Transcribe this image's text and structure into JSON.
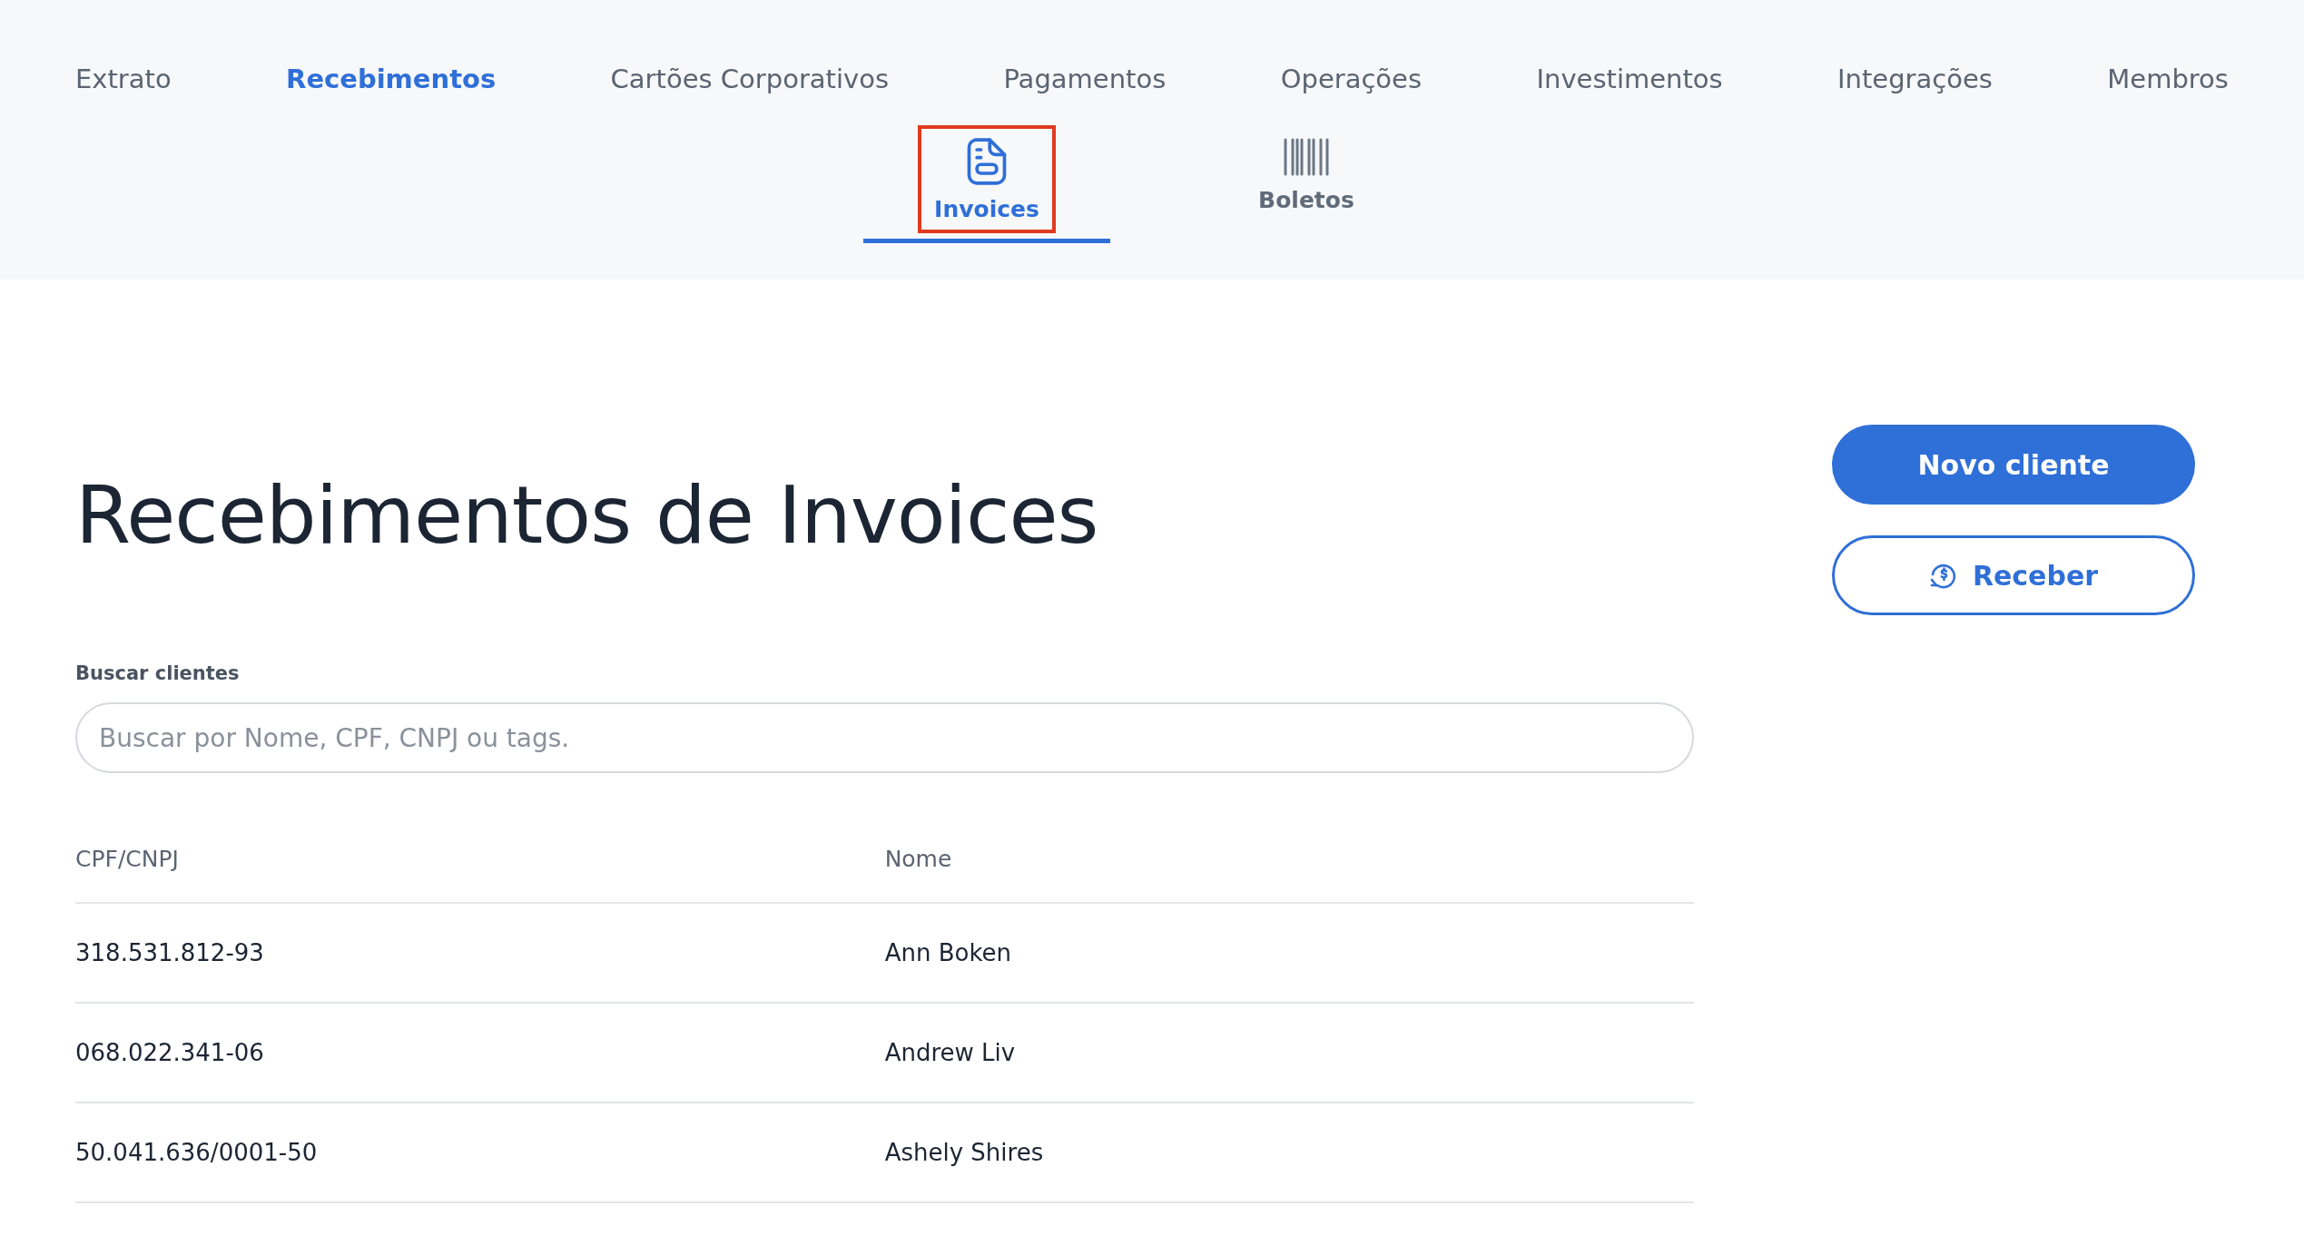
{
  "nav": {
    "items": [
      {
        "label": "Extrato",
        "selected": false
      },
      {
        "label": "Recebimentos",
        "selected": true
      },
      {
        "label": "Cartões Corporativos",
        "selected": false
      },
      {
        "label": "Pagamentos",
        "selected": false
      },
      {
        "label": "Operações",
        "selected": false
      },
      {
        "label": "Investimentos",
        "selected": false
      },
      {
        "label": "Integrações",
        "selected": false
      },
      {
        "label": "Membros",
        "selected": false
      }
    ]
  },
  "subnav": {
    "items": [
      {
        "label": "Invoices",
        "kind": "invoice",
        "selected": true,
        "highlighted": true
      },
      {
        "label": "Boletos",
        "kind": "barcode",
        "selected": false,
        "highlighted": false
      }
    ]
  },
  "title": "Recebimentos de Invoices",
  "buttons": [
    {
      "label": "Novo cliente",
      "kind": "primary"
    },
    {
      "label": "Receber",
      "kind": "secondary"
    }
  ],
  "search": {
    "label": "Buscar clientes",
    "placeholder": "Buscar por Nome, CPF, CNPJ ou tags."
  },
  "table": {
    "columns": [
      "CPF/CNPJ",
      "Nome"
    ],
    "rows": [
      [
        "318.531.812-93",
        "Ann Boken"
      ],
      [
        "068.022.341-06",
        "Andrew Liv"
      ],
      [
        "50.041.636/0001-50",
        "Ashely Shires"
      ]
    ]
  }
}
